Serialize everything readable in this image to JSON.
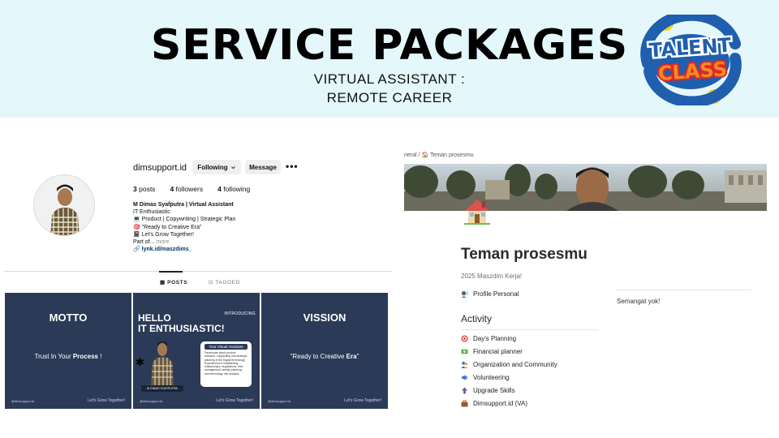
{
  "banner": {
    "title": "SERVICE PACKAGES",
    "subtitle_line1": "VIRTUAL ASSISTANT :",
    "subtitle_line2": "REMOTE CAREER",
    "background": "#e4f7fb"
  },
  "logo": {
    "line1": "TALENT",
    "line2": "CLASS",
    "colors": {
      "blue": "#1f5fae",
      "orange": "#f28b1f",
      "yellow": "#f8d21c",
      "red": "#e2262b"
    }
  },
  "instagram": {
    "username": "dimsupport.id",
    "following_button": "Following",
    "message_button": "Message",
    "more_icon": "more-horizontal-icon",
    "stats": {
      "posts_count": "3",
      "posts_label": "posts",
      "followers_count": "4",
      "followers_label": "followers",
      "following_count": "4",
      "following_label": "following"
    },
    "bio": {
      "name": "M Dimas Syafputra | Virtual Assistant",
      "line1": "IT Enthusiastic",
      "line2": "💻 Product | Copywriting | Strategic Plan",
      "line3": "🎯 \"Ready to Creative Era\"",
      "line4": "📓 Let's Grow Together!",
      "line5": "Part of...",
      "more": "more",
      "link": "lynk.id/maszdims_"
    },
    "tabs": {
      "posts": "POSTS",
      "tagged": "TAGGED"
    },
    "posts": [
      {
        "title": "MOTTO",
        "text_plain": "Trust In Your ",
        "text_bold": "Process",
        "text_end": " !",
        "footer_left": "@dimsupport.id",
        "footer_right": "Let's Grow Together!"
      },
      {
        "head_line1": "HELLO",
        "head_line2": "IT ENTHUSIASTIC!",
        "intro": "INTRODUCING",
        "card_title": "Your Virtual Assistant",
        "card_text": "Passionate about product research, copywriting and strategic planning in the Digital technology. Experienced in establishing relationships, negotiations, time management, activity planning, and technology risk analysis.",
        "name_tag": "M DIMAS SYAFPUTRA",
        "footer_left": "@dimsupport.id",
        "footer_right": "Let's Grow Together!"
      },
      {
        "title": "VISSION",
        "text_plain": "\"Ready to Creative ",
        "text_bold": "Era",
        "text_end": "\"",
        "footer_left": "@dimsupport.id",
        "footer_right": "Let's Grow Together!"
      }
    ],
    "post_bg": "#2b3a57"
  },
  "notion": {
    "breadcrumb_prefix": "neral",
    "breadcrumb_sep": "/",
    "breadcrumb_page": "Teman prosesmu",
    "page_icon": "house-icon",
    "title": "Teman prosesmu",
    "subtitle": "2025 Maszdim Kerja!",
    "profile_item": {
      "icon": "speaking-head-icon",
      "label": "Profile Personal"
    },
    "activity_heading": "Activity",
    "activity_items": [
      {
        "icon": "target-icon",
        "label": "Day's Planning"
      },
      {
        "icon": "money-icon",
        "label": "Financial planner"
      },
      {
        "icon": "people-icon",
        "label": "Organization and Community"
      },
      {
        "icon": "megaphone-icon",
        "label": "Volunteering"
      },
      {
        "icon": "upgrade-icon",
        "label": "Upgrade Skills"
      },
      {
        "icon": "briefcase-icon",
        "label": "Dimsupport.id (VA)"
      }
    ],
    "right_text": "Semangat yok!"
  }
}
